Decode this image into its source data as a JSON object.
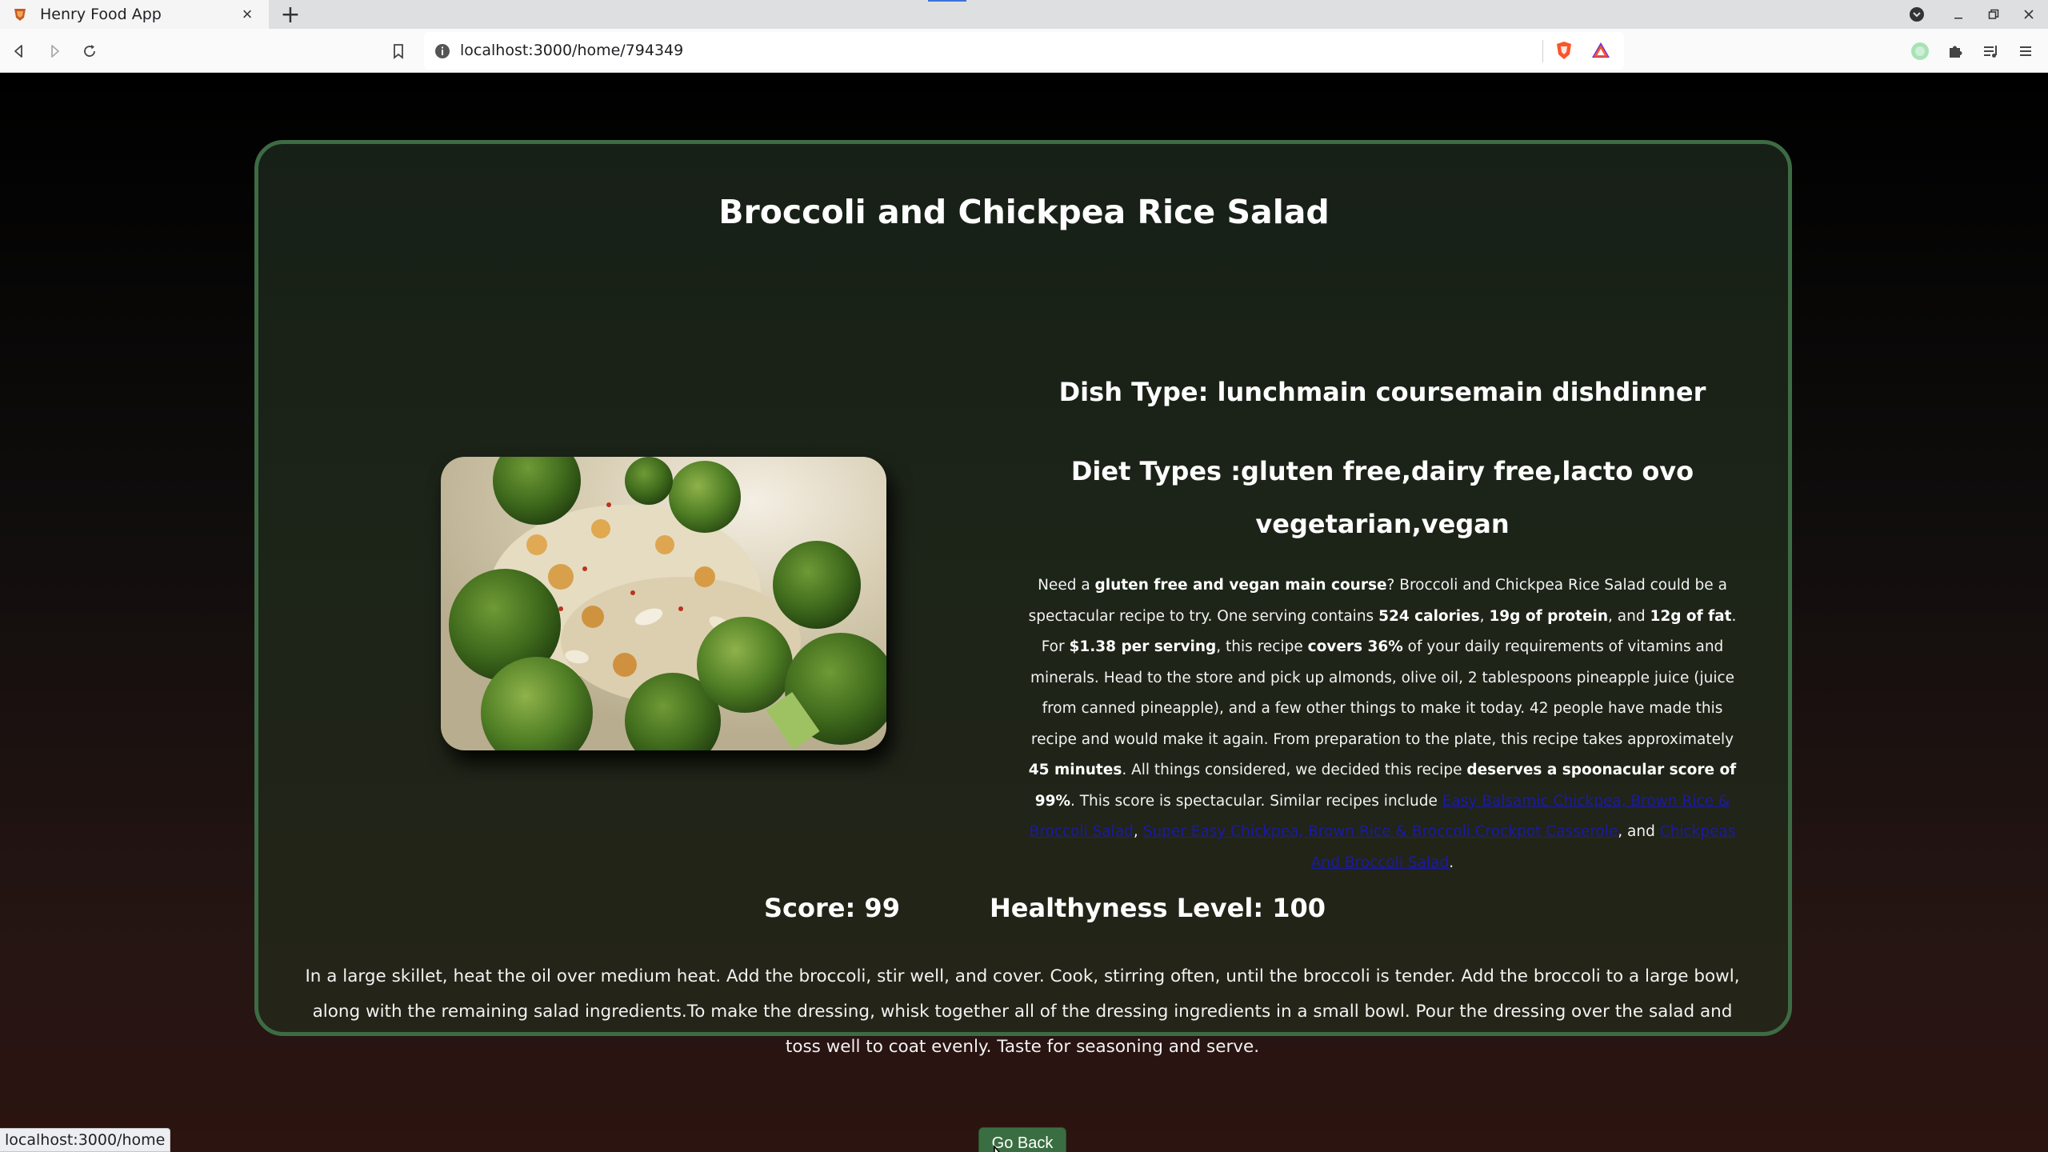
{
  "browser": {
    "tab_title": "Henry Food App",
    "url": "localhost:3000/home/794349",
    "status_url": "localhost:3000/home"
  },
  "recipe": {
    "title": "Broccoli and Chickpea Rice Salad",
    "dish_type": "Dish Type: lunchmain coursemain dishdinner",
    "diet_types": "Diet Types :gluten free,dairy free,lacto ovo vegetarian,vegan",
    "summary": {
      "p1": "Need a ",
      "b1": "gluten free and vegan main course",
      "p2": "? Broccoli and Chickpea Rice Salad could be a spectacular recipe to try. One serving contains ",
      "b2": "524 calories",
      "p3": ", ",
      "b3": "19g of protein",
      "p4": ", and ",
      "b4": "12g of fat",
      "p5": ". For ",
      "b5": "$1.38 per serving",
      "p6": ", this recipe ",
      "b6": "covers 36%",
      "p7": " of your daily requirements of vitamins and minerals. Head to the store and pick up almonds, olive oil, 2 tablespoons pineapple juice (juice from canned pineapple), and a few other things to make it today. 42 people have made this recipe and would make it again. From preparation to the plate, this recipe takes approximately ",
      "b7": "45 minutes",
      "p8": ". All things considered, we decided this recipe ",
      "b8": "deserves a spoonacular score of 99%",
      "p9": ". This score is spectacular. Similar recipes include ",
      "link1": "Easy Balsamic Chickpea, Brown Rice & Broccoli Salad",
      "p10": ", ",
      "link2": "Super Easy Chickpea, Brown Rice & Broccoli Crockpot Casserole",
      "p11": ", and ",
      "link3": "Chickpeas And Broccoli Salad",
      "p12": "."
    },
    "score": "Score: 99",
    "healthyness": "Healthyness Level: 100",
    "instructions": "In a large skillet, heat the oil over medium heat. Add the broccoli, stir well, and cover. Cook, stirring often, until the broccoli is tender. Add the broccoli to a large bowl, along with the remaining salad ingredients.To make the dressing, whisk together all of the dressing ingredients in a small bowl. Pour the dressing over the salad and toss well to coat evenly. Taste for seasoning and serve.",
    "go_back_label": "Go Back",
    "image_alt_name": "broccoli-chickpea-rice-salad-photo"
  },
  "icons": {
    "favicon": "brave-lion-icon",
    "close": "close-icon",
    "new_tab": "plus-icon",
    "back": "back-arrow-icon",
    "forward": "forward-arrow-icon",
    "reload": "reload-icon",
    "bookmark": "bookmark-icon",
    "site_info": "info-icon",
    "shields": "brave-shield-icon",
    "rewards": "brave-rewards-icon",
    "extensions": "puzzle-icon",
    "reading_list": "playlist-icon",
    "menu": "hamburger-icon"
  },
  "colors": {
    "card_border": "#3d6b44",
    "button_bg": "#3a6e42",
    "link": "#1a1aa6"
  }
}
